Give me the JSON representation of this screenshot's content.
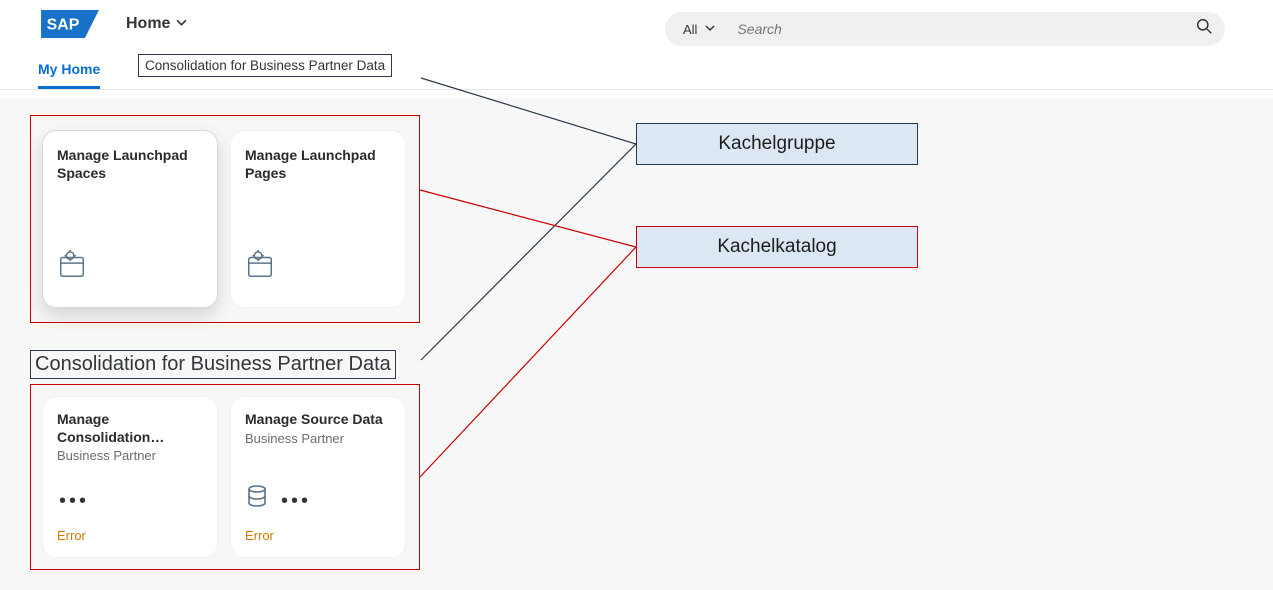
{
  "header": {
    "logo_text": "SAP",
    "title": "Home",
    "search_filter": "All",
    "search_placeholder": "Search"
  },
  "tabs": {
    "my_home": "My Home",
    "consolidation": "Consolidation for Business Partner Data"
  },
  "group1": {
    "tiles": [
      {
        "title": "Manage Launchpad Spaces"
      },
      {
        "title": "Manage Launchpad Pages"
      }
    ]
  },
  "group2": {
    "heading": "Consolidation for Business Partner Data",
    "tiles": [
      {
        "title": "Manage Consolidation…",
        "subtitle": "Business Partner",
        "error": "Error"
      },
      {
        "title": "Manage Source Data",
        "subtitle": "Business Partner",
        "error": "Error"
      }
    ]
  },
  "annotations": {
    "kachelgruppe": "Kachelgruppe",
    "kachelkatalog": "Kachelkatalog"
  },
  "colors": {
    "brand_blue": "#0a6ed1",
    "sap_logo_blue": "#1873c8",
    "error_text": "#d17a00",
    "annotation_red": "#cc0000",
    "annotation_dark": "#2a3a4a",
    "callout_bg": "#dbe8f4"
  }
}
